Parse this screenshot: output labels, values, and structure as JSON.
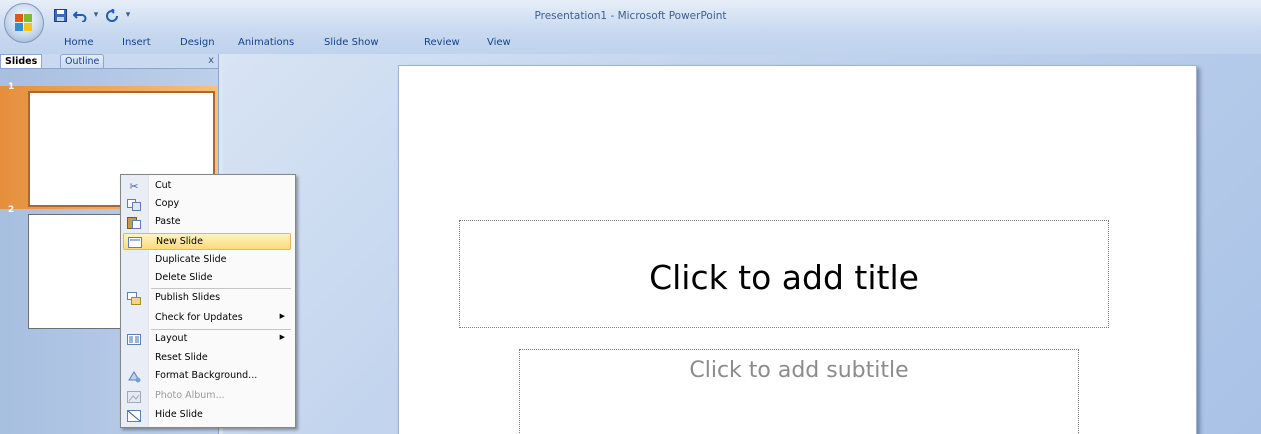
{
  "window": {
    "title": "Presentation1 - Microsoft PowerPoint"
  },
  "quick_access": {
    "icons": [
      "save-icon",
      "undo-icon",
      "redo-icon",
      "customize-icon"
    ]
  },
  "ribbon": {
    "tabs": [
      "Home",
      "Insert",
      "Design",
      "Animations",
      "Slide Show",
      "Review",
      "View"
    ]
  },
  "left_pane": {
    "tabs": [
      "Slides",
      "Outline"
    ],
    "close_glyph": "x",
    "slides": [
      {
        "number": "1",
        "selected": true
      },
      {
        "number": "2",
        "selected": false
      }
    ]
  },
  "slide": {
    "title_placeholder": "Click to add title",
    "subtitle_placeholder": "Click to add subtitle"
  },
  "context_menu": {
    "items": [
      {
        "label": "Cut",
        "icon": "scissors-icon",
        "enabled": true
      },
      {
        "label": "Copy",
        "icon": "copy-icon",
        "enabled": true
      },
      {
        "label": "Paste",
        "icon": "paste-icon",
        "enabled": true
      },
      {
        "label": "New Slide",
        "icon": "new-slide-icon",
        "enabled": true,
        "highlighted": true
      },
      {
        "label": "Duplicate Slide",
        "icon": "",
        "enabled": true
      },
      {
        "label": "Delete Slide",
        "icon": "",
        "enabled": true
      },
      {
        "label": "Publish Slides",
        "icon": "publish-icon",
        "enabled": true
      },
      {
        "label": "Check for Updates",
        "icon": "",
        "enabled": true,
        "submenu": true
      },
      {
        "label": "Layout",
        "icon": "layout-icon",
        "enabled": true,
        "submenu": true
      },
      {
        "label": "Reset Slide",
        "icon": "",
        "enabled": true
      },
      {
        "label": "Format Background...",
        "icon": "format-background-icon",
        "enabled": true
      },
      {
        "label": "Photo Album...",
        "icon": "photo-album-icon",
        "enabled": false
      },
      {
        "label": "Hide Slide",
        "icon": "hide-slide-icon",
        "enabled": true
      }
    ]
  },
  "colors": {
    "ribbon_blue": "#c7d8ef",
    "selection_orange": "#e58f3c",
    "menu_highlight": "#ffd97a"
  }
}
